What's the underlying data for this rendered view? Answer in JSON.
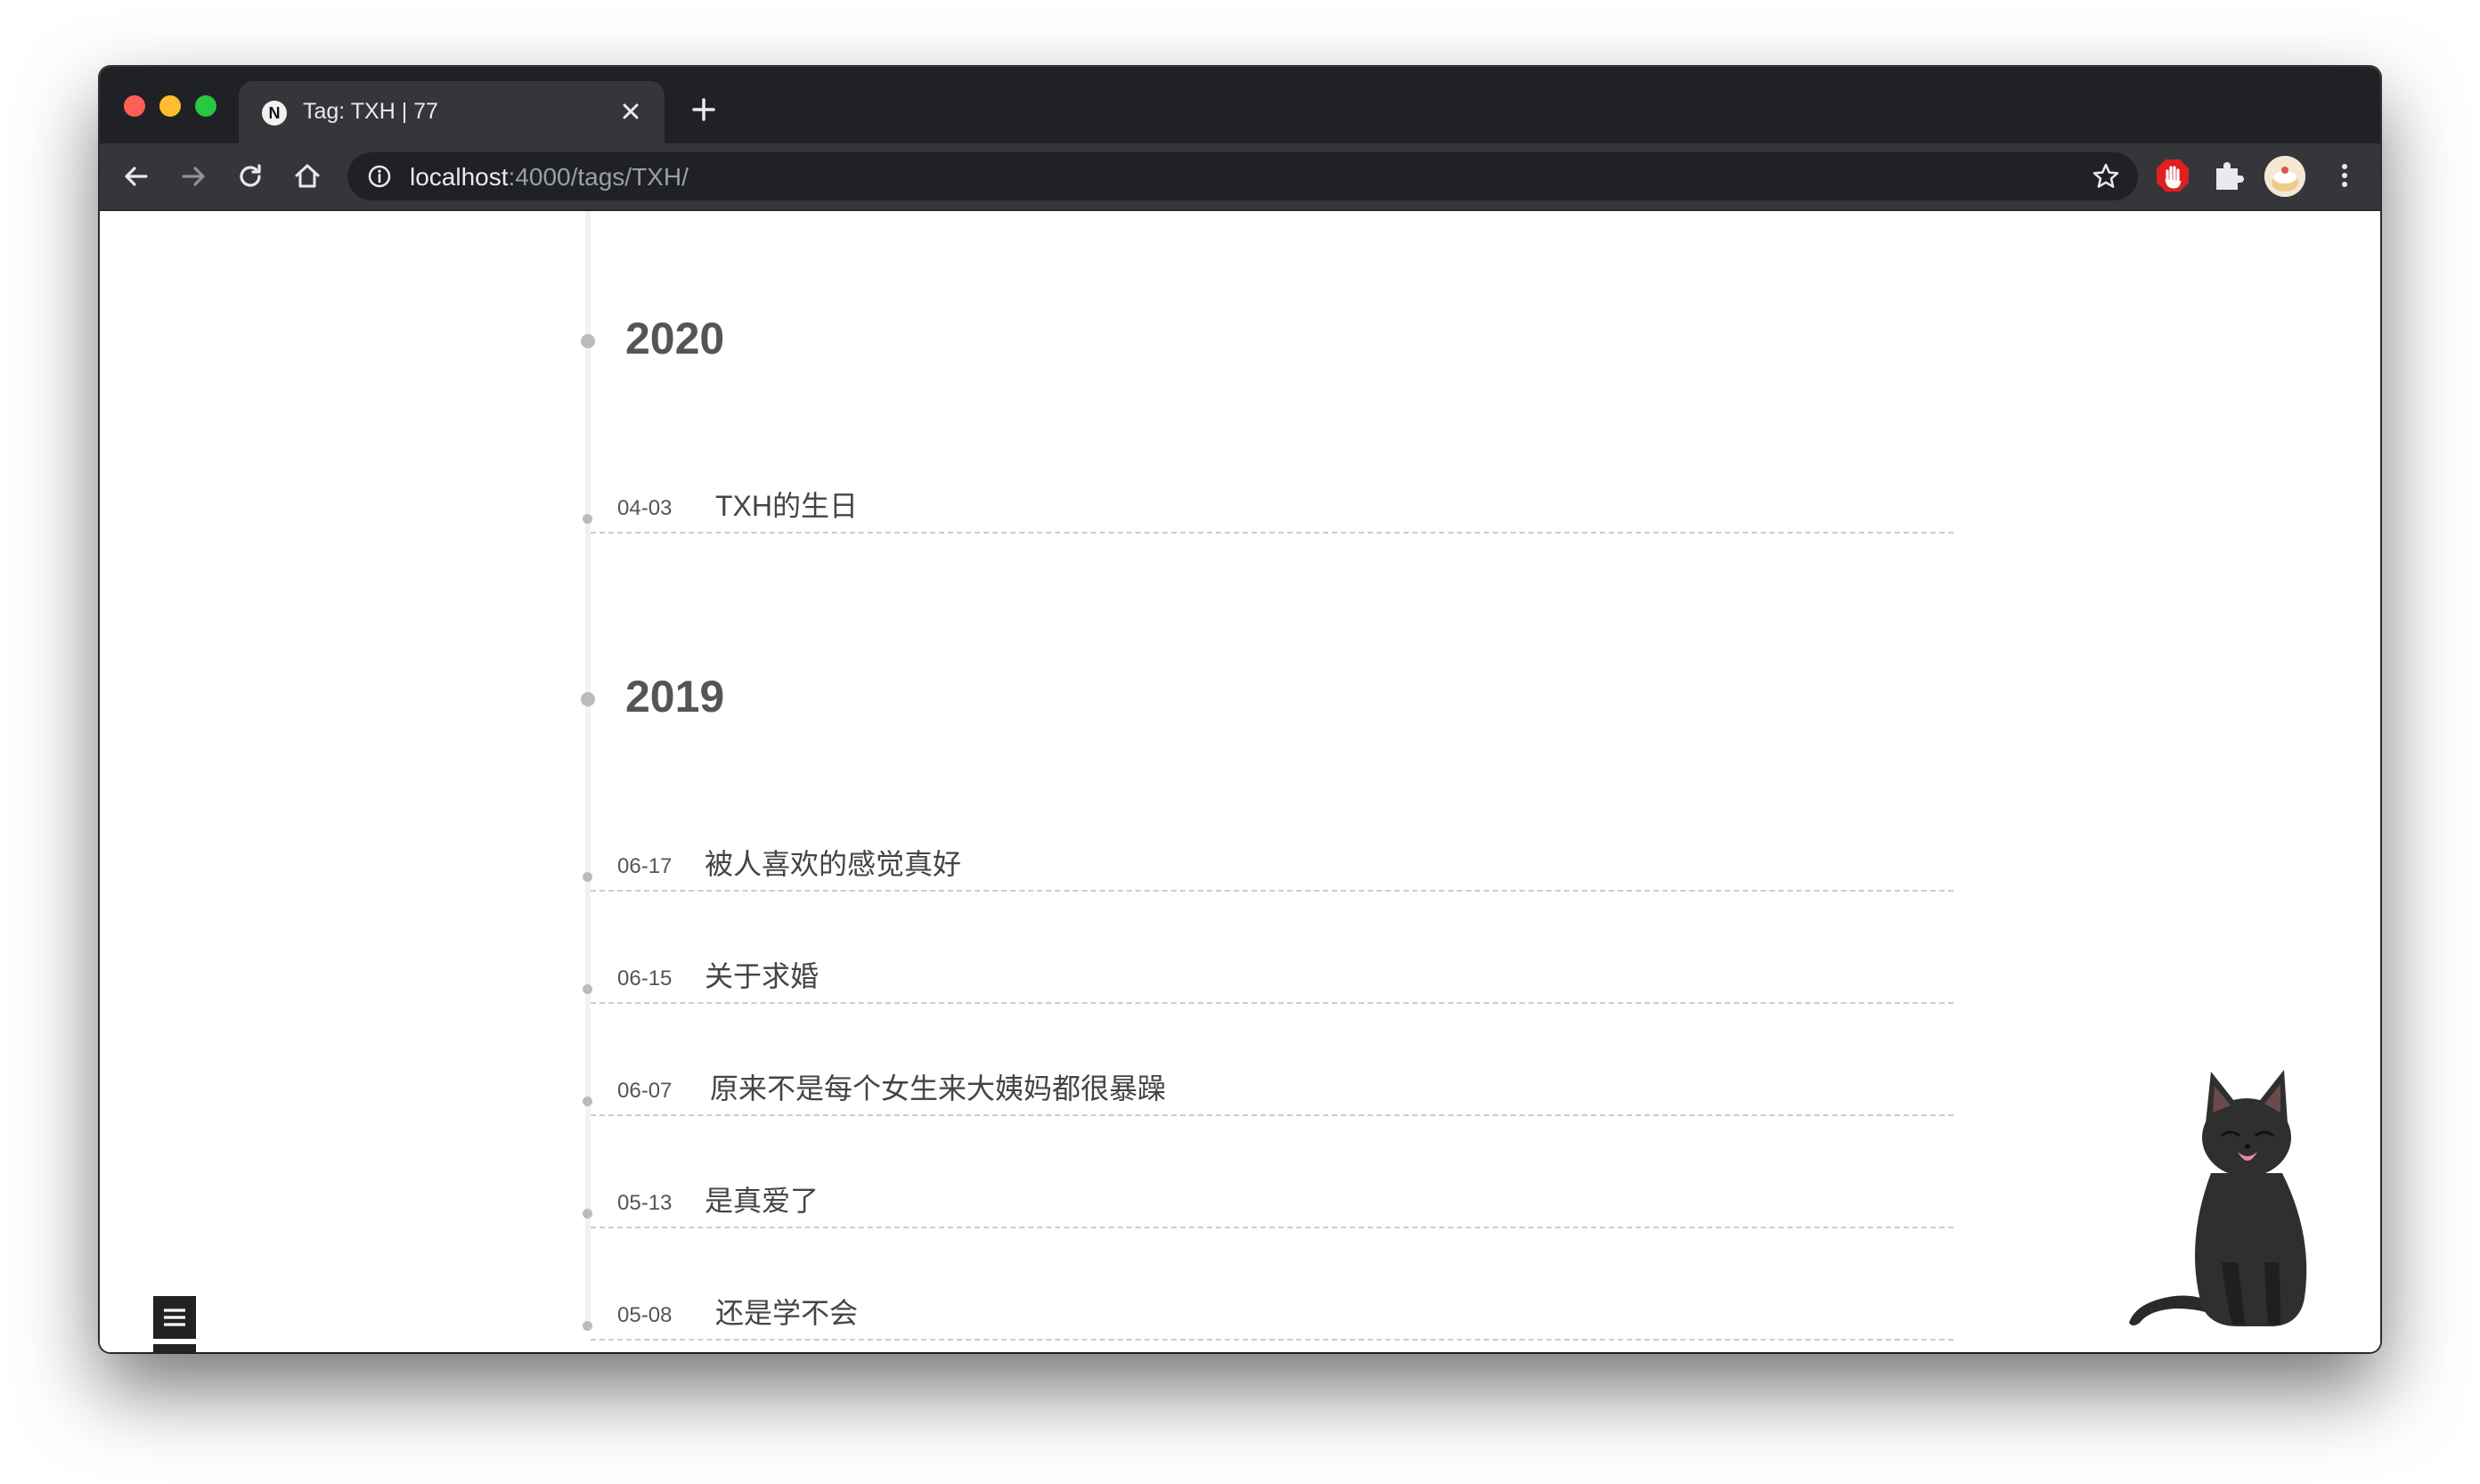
{
  "browser": {
    "tab": {
      "favicon_letter": "N",
      "title": "Tag: TXH | 77"
    },
    "address": {
      "host": "localhost",
      "path": ":4000/tags/TXH/"
    }
  },
  "timeline": {
    "years": [
      {
        "label": "2020",
        "posts": [
          {
            "date": "04-03",
            "title": "TXH的生日"
          }
        ]
      },
      {
        "label": "2019",
        "posts": [
          {
            "date": "06-17",
            "title": "被人喜欢的感觉真好"
          },
          {
            "date": "06-15",
            "title": "关于求婚"
          },
          {
            "date": "06-07",
            "title": "原来不是每个女生来大姨妈都很暴躁"
          },
          {
            "date": "05-13",
            "title": "是真爱了"
          },
          {
            "date": "05-08",
            "title": "还是学不会"
          }
        ]
      }
    ]
  },
  "colors": {
    "chrome_dark": "#202124",
    "chrome_toolbar": "#35363a",
    "timeline_line": "#f2f2f2",
    "dot": "#bbbbbb",
    "text": "#555555",
    "side_button_bg": "#222222"
  },
  "icons": {
    "back": "arrow-left-icon",
    "forward": "arrow-right-icon",
    "reload": "reload-icon",
    "home": "home-icon",
    "site_info": "info-icon",
    "bookmark": "star-icon",
    "adblock": "stop-hand-icon",
    "extensions": "puzzle-icon",
    "profile": "avatar",
    "menu": "kebab-menu-icon",
    "sidebar_toggle": "hamburger-icon",
    "back_to_top": "arrow-up-icon",
    "mascot": "black-cat-mascot"
  }
}
